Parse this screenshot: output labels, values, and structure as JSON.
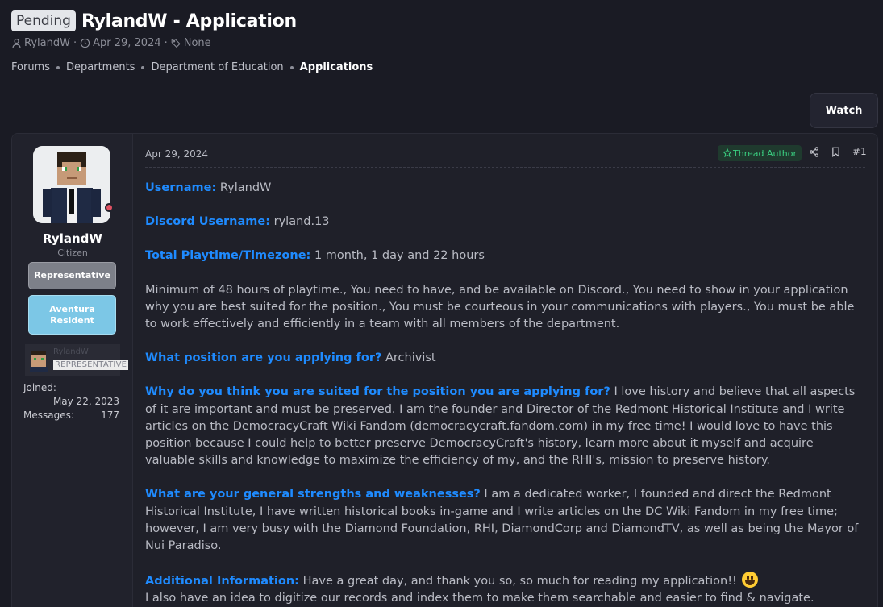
{
  "thread": {
    "status_badge": "Pending",
    "title": "RylandW - Application",
    "author": "RylandW",
    "date": "Apr 29, 2024",
    "tags": "None"
  },
  "breadcrumb": [
    "Forums",
    "Departments",
    "Department of Education",
    "Applications"
  ],
  "actions": {
    "watch_label": "Watch"
  },
  "post": {
    "date": "Apr 29, 2024",
    "author_badge": "Thread Author",
    "number": "#1",
    "user": {
      "name": "RylandW",
      "title": "Citizen",
      "banners": [
        "Representative",
        "Aventura Resident"
      ],
      "mini_name": "RylandW",
      "mini_badge": "REPRESENTATIVE",
      "joined_label": "Joined:",
      "joined_value": "May 22, 2023",
      "messages_label": "Messages:",
      "messages_value": "177"
    },
    "fields": {
      "username_label": "Username:",
      "username_value": " RylandW",
      "discord_label": "Discord Username:",
      "discord_value": " ryland.13",
      "playtime_label": "Total Playtime/Timezone:",
      "playtime_value": " 1 month, 1 day and 22 hours",
      "requirements": "Minimum of 48 hours of playtime., You need to have, and be available on Discord., You need to show in your application why you are best suited for the position., You must be courteous in your communications with players., You must be able to work effectively and efficiently in a team with all members of the department.",
      "position_label": "What position are you applying for?",
      "position_value": " Archivist",
      "suited_label": "Why do you think you are suited for the position you are applying for?",
      "suited_value": " I love history and believe that all aspects of it are important and must be preserved. I am the founder and Director of the Redmont Historical Institute and I write articles on the DemocracyCraft Wiki Fandom (democracycraft.fandom.com) in my free time! I would love to have this position because I could help to better preserve DemocracyCraft's history, learn more about it myself and acquire valuable skills and knowledge to maximize the efficiency of my, and the RHI's, mission to preserve history.",
      "strengths_label": "What are your general strengths and weaknesses?",
      "strengths_value": " I am a dedicated worker, I founded and direct the Redmont Historical Institute, I have written historical books in-game and I write articles on the DC Wiki Fandom in my free time; however, I am very busy with the Diamond Foundation, RHI, DiamondCorp and DiamondTV, as well as being the Mayor of Nui Paradiso.",
      "additional_label": "Additional Information:",
      "additional_value": " Have a great day, and thank you so, so much for reading my application!! ",
      "additional_line2": "I also have an idea to digitize our records and index them to make them searchable and easier to find & navigate."
    }
  },
  "colors": {
    "background": "#1a1b24",
    "label_blue": "#1f8bff",
    "author_green": "#3ad081",
    "online_red": "#e05263"
  },
  "icons": [
    "user-icon",
    "clock-icon",
    "tag-icon",
    "star-icon",
    "share-icon",
    "bookmark-icon",
    "grin-emoji-icon"
  ]
}
